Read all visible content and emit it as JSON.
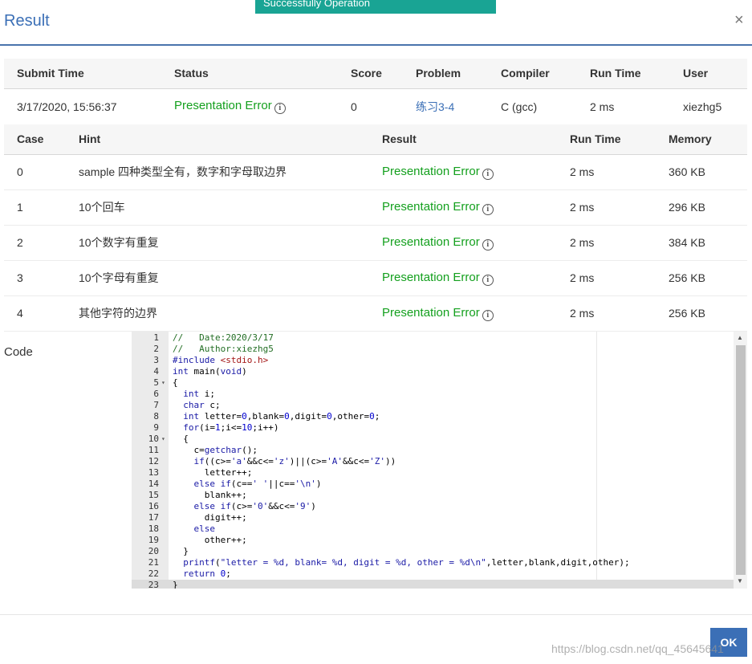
{
  "toast": {
    "text": "Successfully Operation"
  },
  "dialog": {
    "title": "Result",
    "close_label": "×"
  },
  "submission": {
    "headers": [
      "Submit Time",
      "Status",
      "Score",
      "Problem",
      "Compiler",
      "Run Time",
      "User"
    ],
    "submit_time": "3/17/2020, 15:56:37",
    "status": "Presentation Error",
    "score": "0",
    "problem": "练习3-4",
    "compiler": "C (gcc)",
    "run_time": "2 ms",
    "user": "xiezhg5"
  },
  "cases": {
    "headers": [
      "Case",
      "Hint",
      "Result",
      "Run Time",
      "Memory"
    ],
    "rows": [
      {
        "case": "0",
        "hint": "sample 四种类型全有，数字和字母取边界",
        "result": "Presentation Error",
        "run_time": "2 ms",
        "memory": "360 KB"
      },
      {
        "case": "1",
        "hint": "10个回车",
        "result": "Presentation Error",
        "run_time": "2 ms",
        "memory": "296 KB"
      },
      {
        "case": "2",
        "hint": "10个数字有重复",
        "result": "Presentation Error",
        "run_time": "2 ms",
        "memory": "384 KB"
      },
      {
        "case": "3",
        "hint": "10个字母有重复",
        "result": "Presentation Error",
        "run_time": "2 ms",
        "memory": "256 KB"
      },
      {
        "case": "4",
        "hint": "其他字符的边界",
        "result": "Presentation Error",
        "run_time": "2 ms",
        "memory": "256 KB"
      }
    ]
  },
  "code": {
    "label": "Code",
    "active_line": 23,
    "fold_lines": [
      5,
      10
    ],
    "lines": [
      "//   Date:2020/3/17",
      "//   Author:xiezhg5",
      "#include <stdio.h>",
      "int main(void)",
      "{",
      "  int i;",
      "  char c;",
      "  int letter=0,blank=0,digit=0,other=0;",
      "  for(i=1;i<=10;i++)",
      "  {",
      "    c=getchar();",
      "    if((c>='a'&&c<='z')||(c>='A'&&c<='Z'))",
      "      letter++;",
      "    else if(c==' '||c=='\\n')",
      "      blank++;",
      "    else if(c>='0'&&c<='9')",
      "      digit++;",
      "    else",
      "      other++;",
      "  }",
      "  printf(\"letter = %d, blank= %d, digit = %d, other = %d\\n\",letter,blank,digit,other);",
      "  return 0;",
      "}"
    ]
  },
  "footer": {
    "ok_label": "OK"
  },
  "watermark": {
    "text": "https://blog.csdn.net/qq_45645641"
  },
  "colors": {
    "accent": "#3b6fb6",
    "success": "#14a01e",
    "toast": "#19a494"
  }
}
